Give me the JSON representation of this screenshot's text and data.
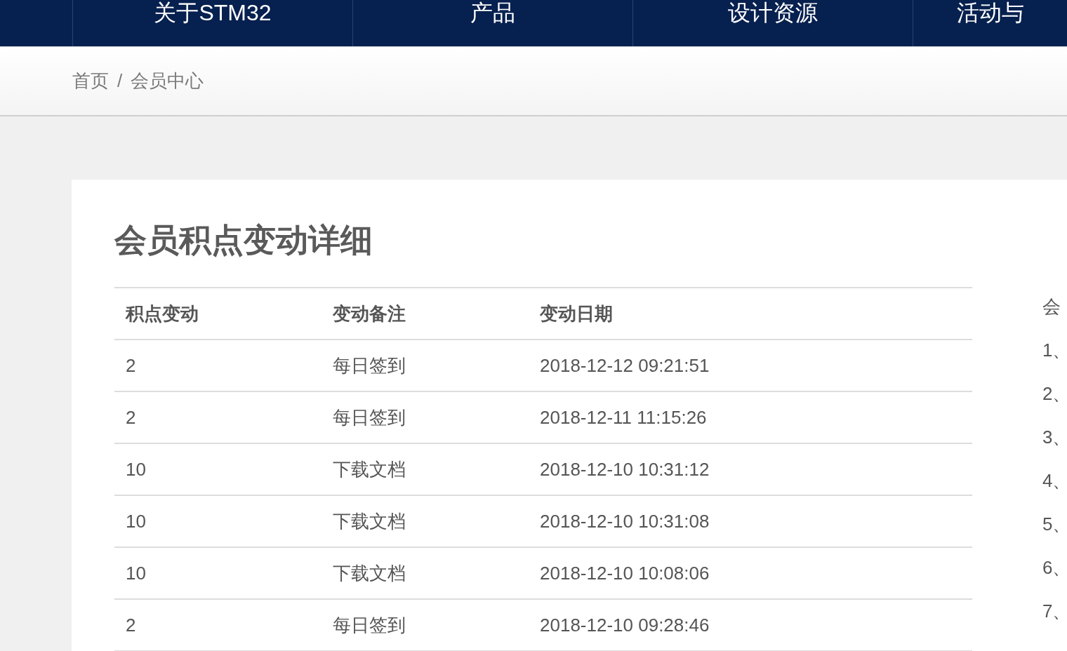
{
  "nav": {
    "items": [
      "关于STM32",
      "产品",
      "设计资源",
      "活动与"
    ]
  },
  "breadcrumb": {
    "items": [
      "首页",
      "会员中心"
    ],
    "separator": "/"
  },
  "page": {
    "title": "会员积点变动详细"
  },
  "table": {
    "columns": [
      "积点变动",
      "变动备注",
      "变动日期"
    ],
    "rows": [
      [
        "2",
        "每日签到",
        "2018-12-12 09:21:51"
      ],
      [
        "2",
        "每日签到",
        "2018-12-11 11:15:26"
      ],
      [
        "10",
        "下载文档",
        "2018-12-10 10:31:12"
      ],
      [
        "10",
        "下载文档",
        "2018-12-10 10:31:08"
      ],
      [
        "10",
        "下载文档",
        "2018-12-10 10:08:06"
      ],
      [
        "2",
        "每日签到",
        "2018-12-10 09:28:46"
      ]
    ]
  },
  "side_panel": {
    "heading": "会",
    "items": [
      "1、",
      "2、",
      "3、",
      "4、",
      "5、",
      "6、",
      "7、"
    ]
  }
}
